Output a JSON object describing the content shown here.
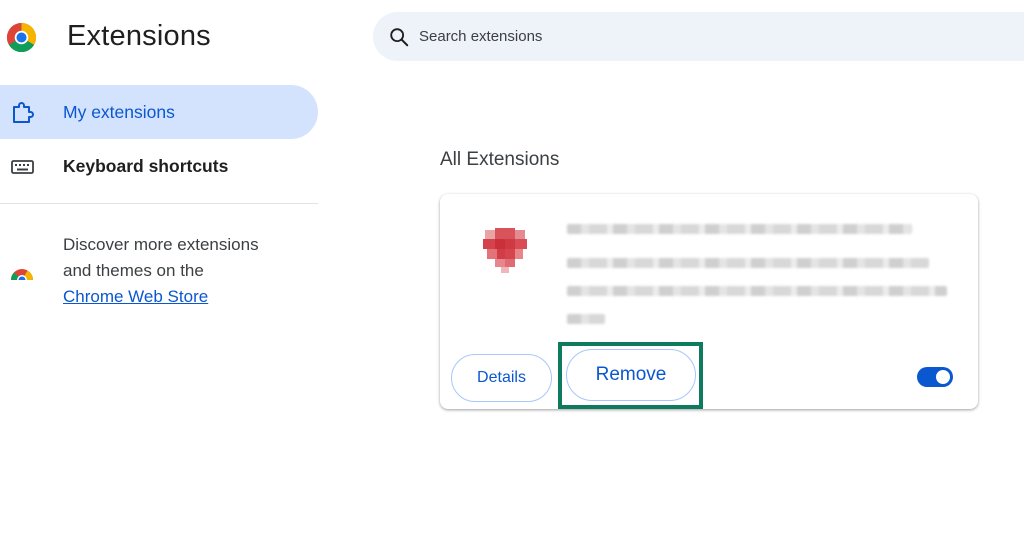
{
  "header": {
    "title": "Extensions",
    "logo_icon": "chrome-logo-icon"
  },
  "search": {
    "placeholder": "Search extensions",
    "icon": "search-icon"
  },
  "sidebar": {
    "items": [
      {
        "label": "My extensions",
        "icon": "extension-puzzle-icon",
        "active": true
      },
      {
        "label": "Keyboard shortcuts",
        "icon": "keyboard-icon",
        "active": false
      }
    ],
    "promo": {
      "line1": "Discover more extensions",
      "line2": "and themes on the",
      "link": "Chrome Web Store",
      "icon": "chrome-web-store-icon"
    }
  },
  "main": {
    "section_title": "All Extensions",
    "extension_card": {
      "icon": "heart-extension-icon",
      "details_label": "Details",
      "remove_label": "Remove",
      "enabled": true
    }
  },
  "colors": {
    "accent": "#0b57d0",
    "active_nav_bg": "#d3e3fd",
    "search_bg": "#eef2f9",
    "highlight": "#0e7a5e"
  }
}
